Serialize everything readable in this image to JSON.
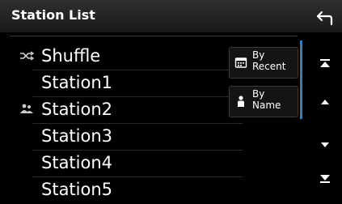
{
  "header": {
    "title": "Station List"
  },
  "list": {
    "items": [
      {
        "label": "Shuffle",
        "icon": "shuffle-icon"
      },
      {
        "label": "Station1",
        "icon": ""
      },
      {
        "label": "Station2",
        "icon": "shared-station-icon"
      },
      {
        "label": "Station3",
        "icon": ""
      },
      {
        "label": "Station4",
        "icon": ""
      },
      {
        "label": "Station5",
        "icon": ""
      }
    ]
  },
  "sort": {
    "by_recent": {
      "line1": "By",
      "line2": "Recent",
      "icon": "calendar-icon"
    },
    "by_name": {
      "line1": "By",
      "line2": "Name",
      "icon": "person-icon"
    }
  },
  "scroll": {
    "icons": [
      "scroll-top-icon",
      "scroll-up-icon",
      "scroll-down-icon",
      "scroll-bottom-icon"
    ]
  },
  "colors": {
    "accent": "#2a7fc8",
    "background": "#000000",
    "header": "#262626"
  }
}
